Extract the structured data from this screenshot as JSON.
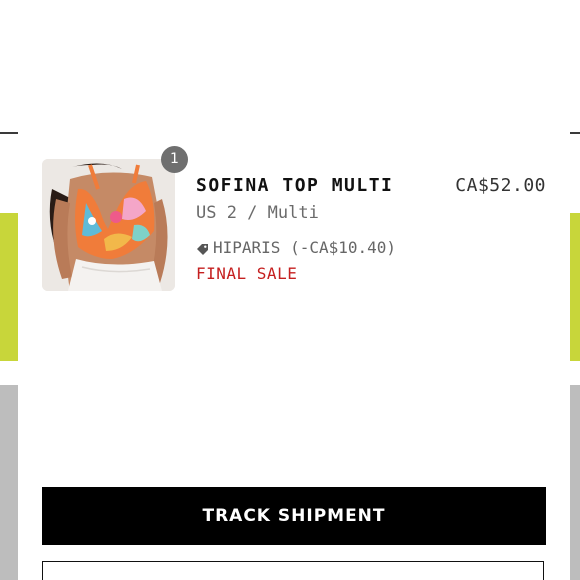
{
  "item": {
    "quantity": "1",
    "name": "SOFINA TOP MULTI",
    "price": "CA$52.00",
    "variant": "US 2 / Multi",
    "discount": "HIPARIS (-CA$10.40)",
    "discount_icon": "price-tag-icon",
    "status": "FINAL SALE",
    "image": "product-photo-floral-halter-top"
  },
  "actions": {
    "track_label": "TRACK SHIPMENT"
  },
  "colors": {
    "final_sale": "#c51f1f",
    "primary_button": "#000000",
    "badge": "#6f6f6f"
  }
}
